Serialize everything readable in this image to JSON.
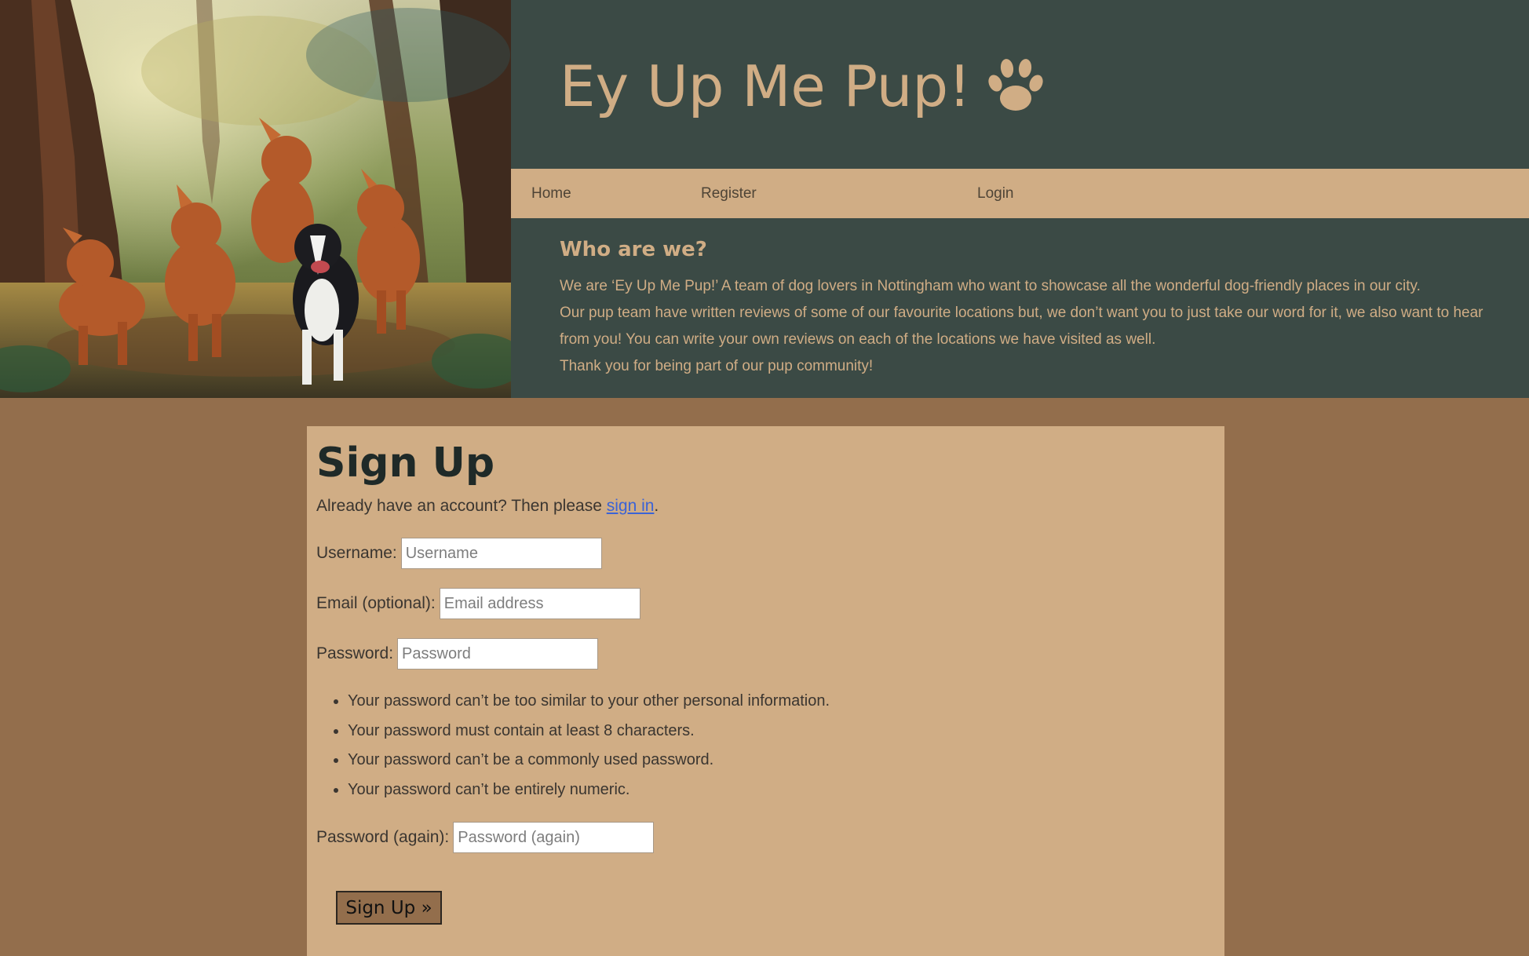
{
  "header": {
    "site_title": "Ey Up Me Pup!",
    "icon": "paw-icon",
    "hero_image": "painting of five dogs running through a sunlit forest"
  },
  "nav": {
    "items": [
      {
        "label": "Home"
      },
      {
        "label": "Register"
      },
      {
        "label": "Login"
      }
    ]
  },
  "about": {
    "heading": "Who are we?",
    "paragraphs": [
      "We are ‘Ey Up Me Pup!’ A team of dog lovers in Nottingham who want to showcase all the wonderful dog-friendly places in our city.",
      "Our pup team have written reviews of some of our favourite locations but, we don’t want you to just take our word for it, we also want to hear from you! You can write your own reviews on each of the locations we have visited as well.",
      "Thank you for being part of our pup community!"
    ]
  },
  "signup": {
    "title": "Sign Up",
    "signin_prefix": "Already have an account? Then please ",
    "signin_link": "sign in",
    "signin_suffix": ".",
    "fields": {
      "username": {
        "label": "Username:",
        "placeholder": "Username",
        "value": ""
      },
      "email": {
        "label": "Email (optional):",
        "placeholder": "Email address",
        "value": ""
      },
      "password": {
        "label": "Password:",
        "placeholder": "Password",
        "value": ""
      },
      "password_again": {
        "label": "Password (again):",
        "placeholder": "Password (again)",
        "value": ""
      }
    },
    "password_help": [
      "Your password can’t be too similar to your other personal information.",
      "Your password must contain at least 8 characters.",
      "Your password can’t be a commonly used password.",
      "Your password can’t be entirely numeric."
    ],
    "submit_label": "Sign Up »"
  },
  "colors": {
    "page_background": "#936e4c",
    "header_dark_green": "#3b4a45",
    "tan_accent": "#d0ad85",
    "link_blue": "#3b63d6"
  }
}
